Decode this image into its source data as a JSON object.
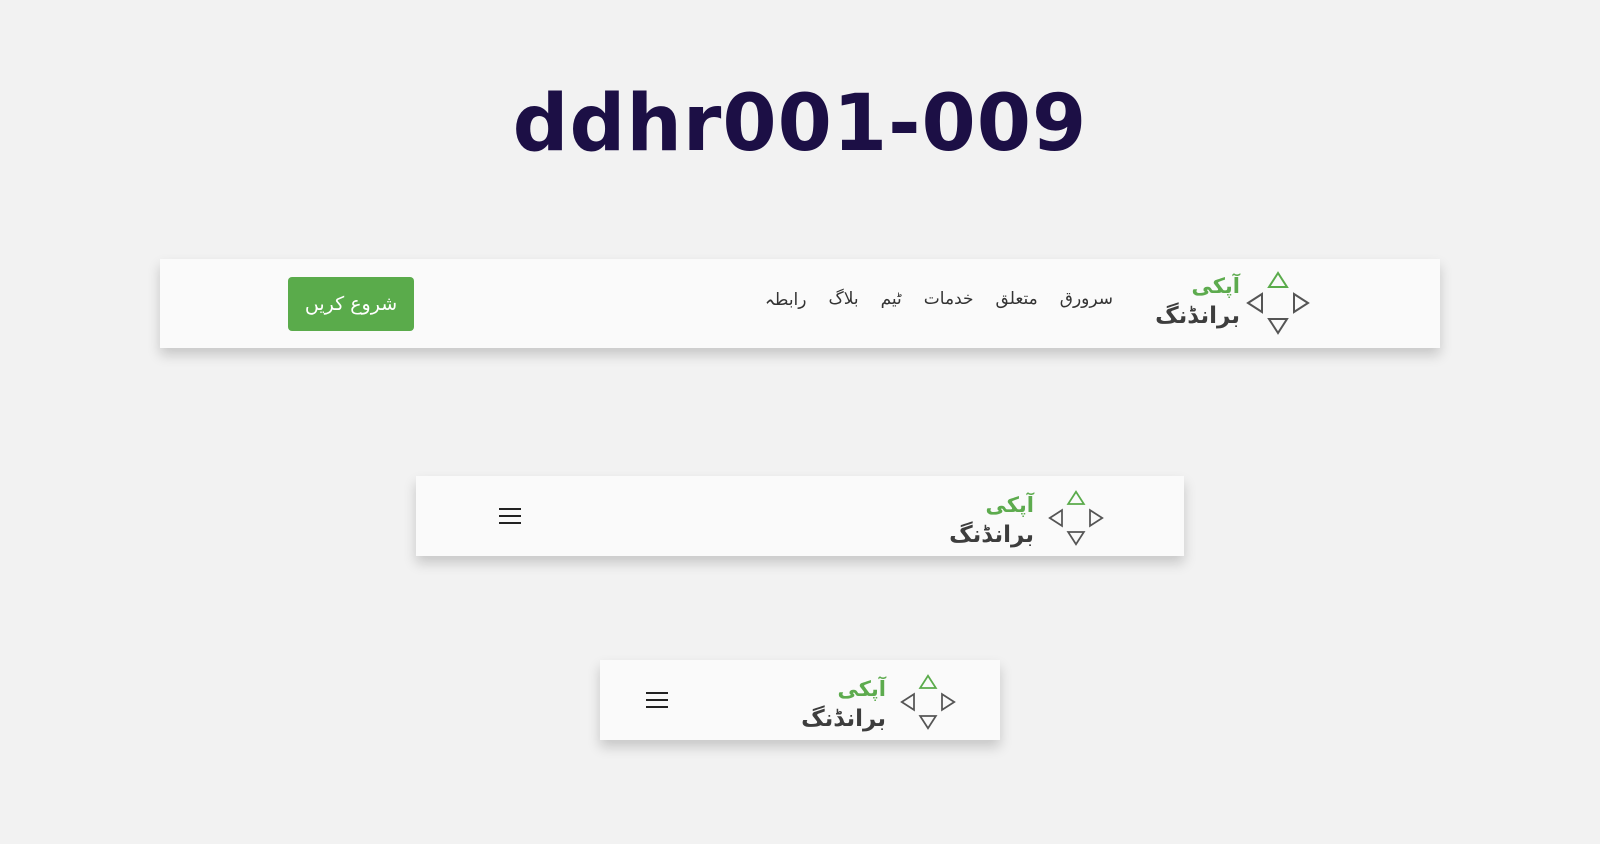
{
  "page": {
    "title": "ddhr001-009"
  },
  "brand": {
    "line1": "آپکی",
    "line2": "برانڈنگ",
    "primary_color": "#5aab4b",
    "icon_color": "#555555",
    "icon": "arrows-diamond-icon"
  },
  "desktop_nav": {
    "links": [
      "سرورق",
      "متعلق",
      "خدمات",
      "ٹیم",
      "بلاگ",
      "رابطہ"
    ],
    "cta_label": "شروع کریں"
  },
  "tablet_nav": {
    "menu_icon": "hamburger-menu-icon"
  },
  "mobile_nav": {
    "menu_icon": "hamburger-menu-icon"
  }
}
